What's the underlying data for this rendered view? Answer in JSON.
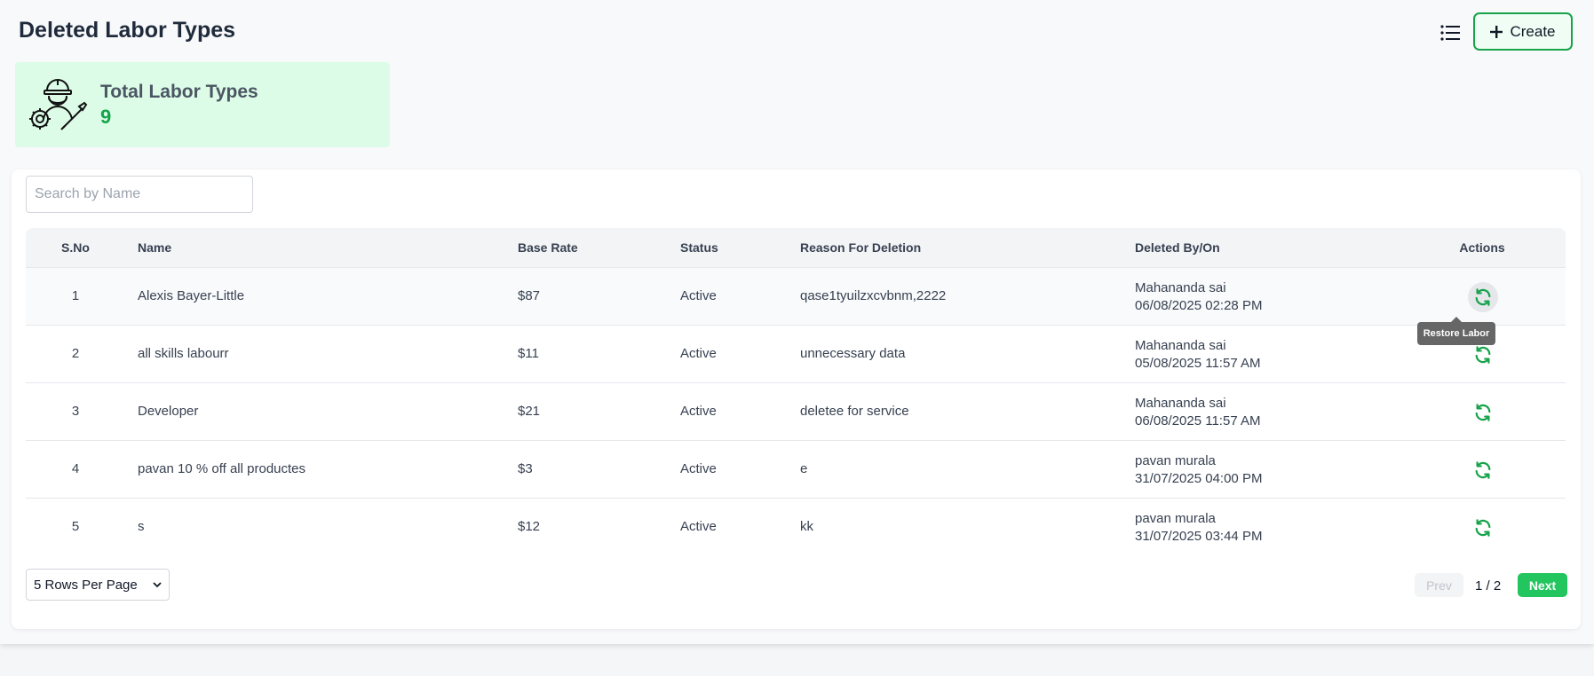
{
  "header": {
    "title": "Deleted Labor Types",
    "create_label": "Create",
    "list_icon": "list-icon",
    "plus_icon": "plus-icon"
  },
  "stat": {
    "label": "Total Labor Types",
    "value": "9",
    "icon": "worker-gear-icon"
  },
  "search": {
    "placeholder": "Search by Name",
    "value": ""
  },
  "table": {
    "columns": [
      "S.No",
      "Name",
      "Base Rate",
      "Status",
      "Reason For Deletion",
      "Deleted By/On",
      "Actions"
    ],
    "rows": [
      {
        "sno": "1",
        "name": "Alexis Bayer-Little",
        "rate": "$87",
        "status": "Active",
        "reason": "qase1tyuilzxcvbnm,2222",
        "deleted_by": "Mahananda sai",
        "deleted_on": "06/08/2025 02:28 PM"
      },
      {
        "sno": "2",
        "name": "all skills labourr",
        "rate": "$11",
        "status": "Active",
        "reason": "unnecessary data",
        "deleted_by": "Mahananda sai",
        "deleted_on": "05/08/2025 11:57 AM"
      },
      {
        "sno": "3",
        "name": "Developer",
        "rate": "$21",
        "status": "Active",
        "reason": "deletee for service",
        "deleted_by": "Mahananda sai",
        "deleted_on": "06/08/2025 11:57 AM"
      },
      {
        "sno": "4",
        "name": "pavan 10 % off all productes",
        "rate": "$3",
        "status": "Active",
        "reason": "e",
        "deleted_by": "pavan murala",
        "deleted_on": "31/07/2025 04:00 PM"
      },
      {
        "sno": "5",
        "name": "s",
        "rate": "$12",
        "status": "Active",
        "reason": "kk",
        "deleted_by": "pavan murala",
        "deleted_on": "31/07/2025 03:44 PM"
      }
    ],
    "restore_tooltip": "Restore Labor",
    "restore_icon": "restore-icon"
  },
  "pagination": {
    "rows_per_page": "5 Rows Per Page",
    "prev_label": "Prev",
    "page_indicator": "1 / 2",
    "next_label": "Next"
  },
  "colors": {
    "accent": "#16a34a",
    "stat_bg": "#dcfce7",
    "next_bg": "#22c55e",
    "tooltip_bg": "#666666"
  }
}
